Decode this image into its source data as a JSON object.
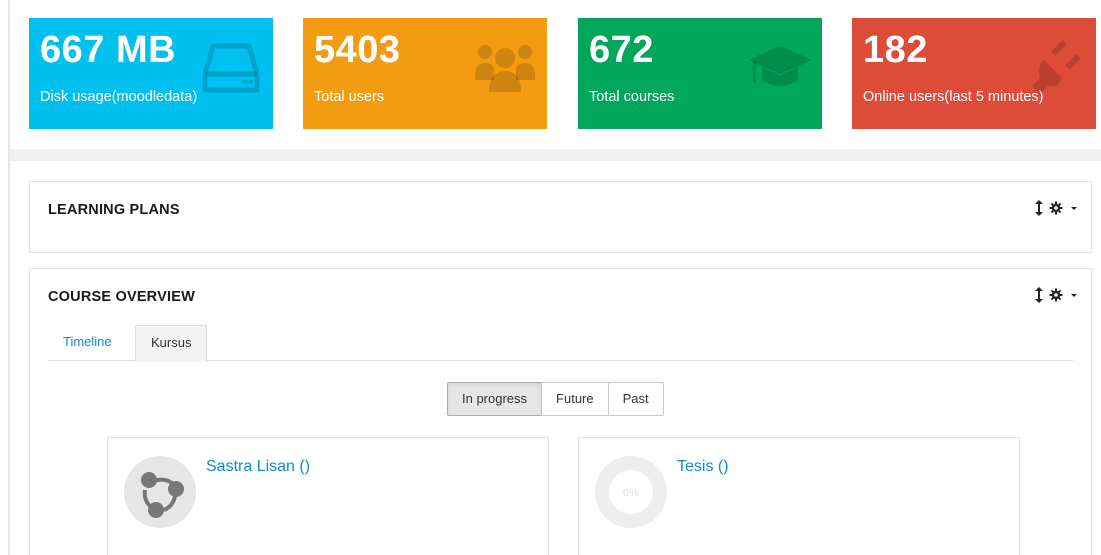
{
  "stats": [
    {
      "value": "667 MB",
      "label": "Disk usage(moodledata)",
      "icon": "hard-drive-icon",
      "color": "#00c0ef"
    },
    {
      "value": "5403",
      "label": "Total users",
      "icon": "users-icon",
      "color": "#f39c12"
    },
    {
      "value": "672",
      "label": "Total courses",
      "icon": "graduation-cap-icon",
      "color": "#00a65a"
    },
    {
      "value": "182",
      "label": "Online users(last 5 minutes)",
      "icon": "plug-icon",
      "color": "#dd4b39"
    }
  ],
  "learning_plans": {
    "title": "LEARNING PLANS"
  },
  "course_overview": {
    "title": "COURSE OVERVIEW",
    "tabs": [
      {
        "label": "Timeline",
        "active": false
      },
      {
        "label": "Kursus",
        "active": true
      }
    ],
    "filters": [
      {
        "label": "In progress",
        "active": true
      },
      {
        "label": "Future",
        "active": false
      },
      {
        "label": "Past",
        "active": false
      }
    ],
    "courses": [
      {
        "title": "Sastra Lisan ()",
        "icon": "course-share-icon"
      },
      {
        "title": "Tesis ()",
        "progress_label": "0%",
        "progress": 0
      }
    ]
  },
  "colors": {
    "link": "#0f8ad0",
    "tab_border": "#dddddd"
  }
}
